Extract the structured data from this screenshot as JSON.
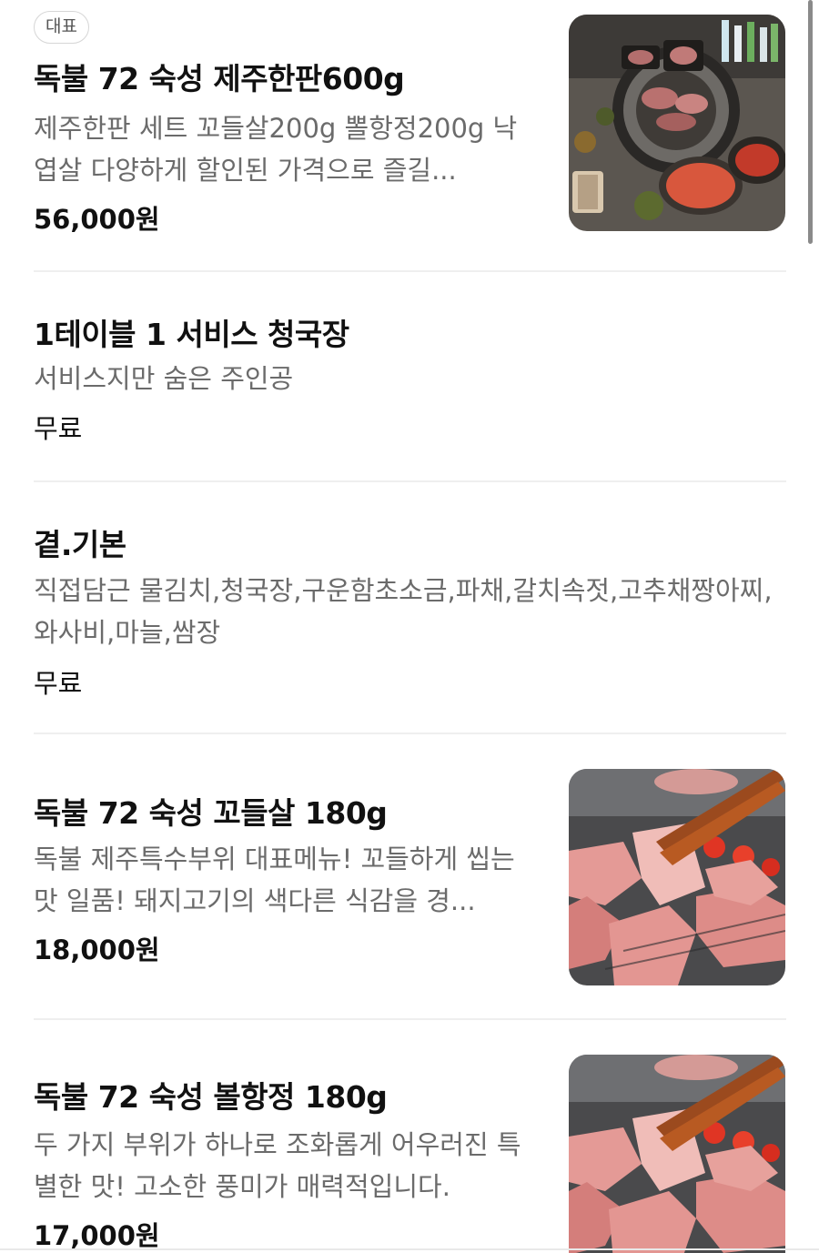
{
  "menu": {
    "items": [
      {
        "badge": "대표",
        "name": "독불 72 숙성 제주한판600g",
        "description": "제주한판 세트 꼬들살200g 뽈항정200g 낙엽살 다양하게 할인된 가격으로 즐길...",
        "price": "56,000원",
        "thumbnail_icon": "grill-table-set-photo"
      },
      {
        "name": "1테이블 1 서비스 청국장",
        "description": "서비스지만 숨은 주인공",
        "price": "무료"
      },
      {
        "name": "곁.기본",
        "description": "직접담근 물김치,청국장,구운함초소금,파채,갈치속젓,고추채짱아찌,와사비,마늘,쌈장",
        "price": "무료"
      },
      {
        "name": "독불 72 숙성 꼬들살 180g",
        "description": "독불 제주특수부위 대표메뉴! 꼬들하게 씹는 맛 일품! 돼지고기의 색다른 식감을 경...",
        "price": "18,000원",
        "thumbnail_icon": "grilled-pork-tongs-photo"
      },
      {
        "name": "독불 72 숙성 볼항정 180g",
        "description": "두 가지 부위가 하나로 조화롭게 어우러진 특별한 맛! 고소한 풍미가 매력적입니다.",
        "price": "17,000원",
        "thumbnail_icon": "grilled-pork-tongs-photo"
      }
    ]
  },
  "colors": {
    "text_primary": "#111111",
    "text_secondary": "#6b6b6b",
    "divider": "#efefef",
    "badge_border": "#d6d6d6"
  }
}
